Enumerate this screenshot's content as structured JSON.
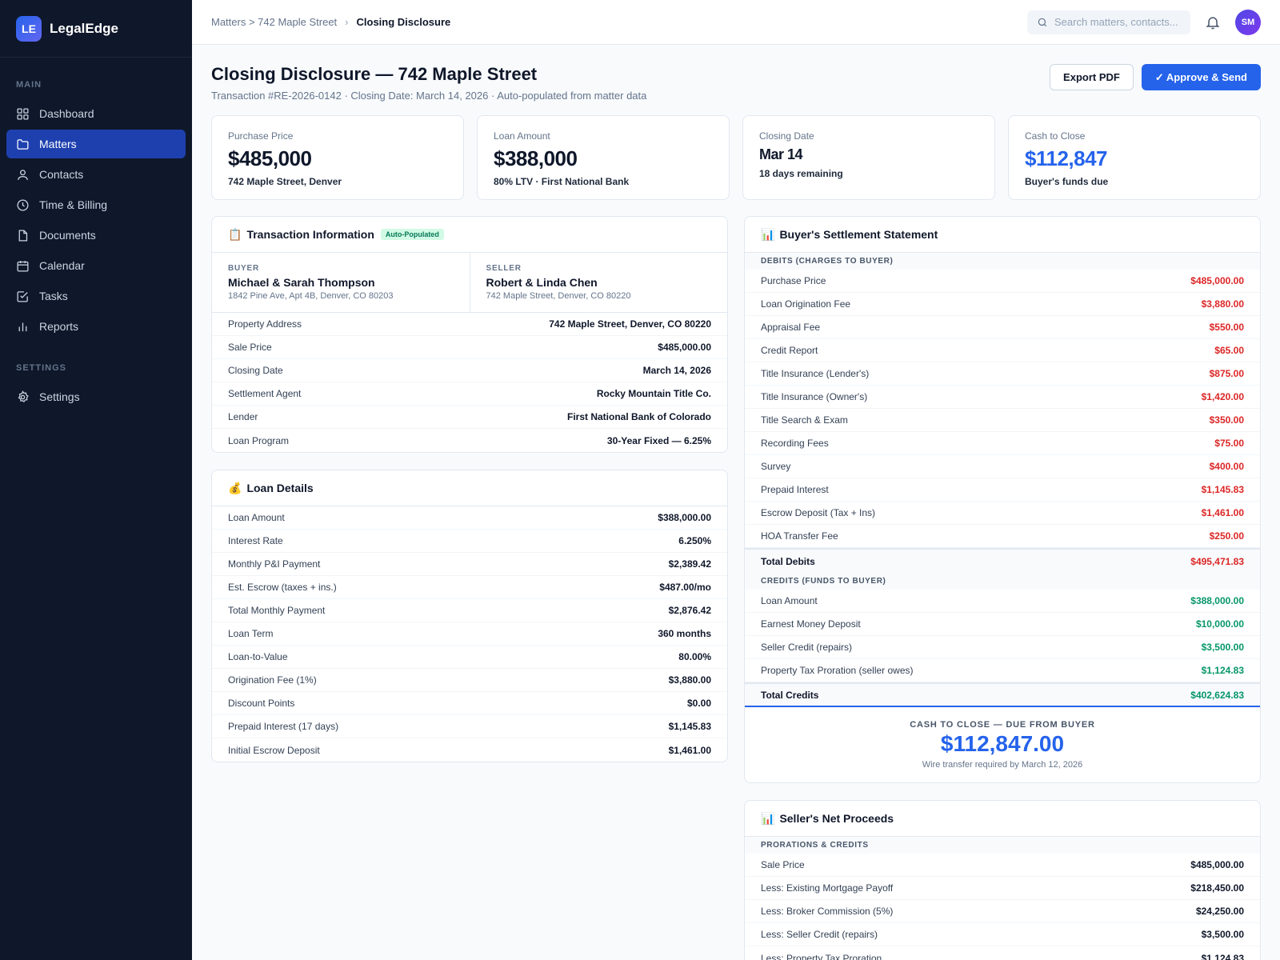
{
  "app": {
    "logo": "LE",
    "name": "LegalEdge"
  },
  "sidebar": {
    "main_label": "MAIN",
    "settings_label": "SETTINGS",
    "items": [
      {
        "label": "Dashboard",
        "icon": "dashboard-icon"
      },
      {
        "label": "Matters",
        "icon": "folder-icon",
        "active": true
      },
      {
        "label": "Contacts",
        "icon": "user-icon"
      },
      {
        "label": "Time & Billing",
        "icon": "clock-icon"
      },
      {
        "label": "Documents",
        "icon": "document-icon"
      },
      {
        "label": "Calendar",
        "icon": "calendar-icon"
      },
      {
        "label": "Tasks",
        "icon": "checkbox-icon"
      },
      {
        "label": "Reports",
        "icon": "bar-chart-icon"
      }
    ],
    "settings_items": [
      {
        "label": "Settings",
        "icon": "gear-icon"
      }
    ]
  },
  "topbar": {
    "breadcrumb_parent": "Matters > 742 Maple Street",
    "breadcrumb_sep": "›",
    "breadcrumb_current": "Closing Disclosure",
    "search_placeholder": "Search matters, contacts...",
    "avatar_initials": "SM"
  },
  "page": {
    "title": "Closing Disclosure — 742 Maple Street",
    "subtitle": "Transaction #RE-2026-0142 · Closing Date: March 14, 2026 · Auto-populated from matter data",
    "export_label": "Export PDF",
    "approve_label": "✓ Approve & Send"
  },
  "stats": [
    {
      "label": "Purchase Price",
      "value": "$485,000",
      "note": "742 Maple Street, Denver"
    },
    {
      "label": "Loan Amount",
      "value": "$388,000",
      "note": "80% LTV · First National Bank"
    },
    {
      "label": "Closing Date",
      "value": "Mar 14",
      "note": "18 days remaining"
    },
    {
      "label": "Cash to Close",
      "value": "$112,847",
      "note": "Buyer's funds due"
    }
  ],
  "transaction": {
    "emoji": "📋",
    "title": "Transaction Information",
    "badge": "Auto-Populated",
    "buyer": {
      "role": "BUYER",
      "name": "Michael & Sarah Thompson",
      "address": "1842 Pine Ave, Apt 4B, Denver, CO 80203"
    },
    "seller": {
      "role": "SELLER",
      "name": "Robert & Linda Chen",
      "address": "742 Maple Street, Denver, CO 80220"
    },
    "rows": [
      {
        "label": "Property Address",
        "value": "742 Maple Street, Denver, CO 80220"
      },
      {
        "label": "Sale Price",
        "value": "$485,000.00"
      },
      {
        "label": "Closing Date",
        "value": "March 14, 2026"
      },
      {
        "label": "Settlement Agent",
        "value": "Rocky Mountain Title Co."
      },
      {
        "label": "Lender",
        "value": "First National Bank of Colorado"
      },
      {
        "label": "Loan Program",
        "value": "30-Year Fixed — 6.25%"
      }
    ]
  },
  "loan": {
    "emoji": "💰",
    "title": "Loan Details",
    "rows": [
      {
        "label": "Loan Amount",
        "value": "$388,000.00"
      },
      {
        "label": "Interest Rate",
        "value": "6.250%"
      },
      {
        "label": "Monthly P&I Payment",
        "value": "$2,389.42"
      },
      {
        "label": "Est. Escrow (taxes + ins.)",
        "value": "$487.00/mo"
      },
      {
        "label": "Total Monthly Payment",
        "value": "$2,876.42"
      },
      {
        "label": "Loan Term",
        "value": "360 months"
      },
      {
        "label": "Loan-to-Value",
        "value": "80.00%"
      },
      {
        "label": "Origination Fee (1%)",
        "value": "$3,880.00"
      },
      {
        "label": "Discount Points",
        "value": "$0.00"
      },
      {
        "label": "Prepaid Interest (17 days)",
        "value": "$1,145.83"
      },
      {
        "label": "Initial Escrow Deposit",
        "value": "$1,461.00"
      }
    ]
  },
  "buyer_statement": {
    "emoji": "📊",
    "title": "Buyer's Settlement Statement",
    "debits_label": "DEBITS (CHARGES TO BUYER)",
    "debits": [
      {
        "label": "Purchase Price",
        "value": "$485,000.00"
      },
      {
        "label": "Loan Origination Fee",
        "value": "$3,880.00"
      },
      {
        "label": "Appraisal Fee",
        "value": "$550.00"
      },
      {
        "label": "Credit Report",
        "value": "$65.00"
      },
      {
        "label": "Title Insurance (Lender's)",
        "value": "$875.00"
      },
      {
        "label": "Title Insurance (Owner's)",
        "value": "$1,420.00"
      },
      {
        "label": "Title Search & Exam",
        "value": "$350.00"
      },
      {
        "label": "Recording Fees",
        "value": "$75.00"
      },
      {
        "label": "Survey",
        "value": "$400.00"
      },
      {
        "label": "Prepaid Interest",
        "value": "$1,145.83"
      },
      {
        "label": "Escrow Deposit (Tax + Ins)",
        "value": "$1,461.00"
      },
      {
        "label": "HOA Transfer Fee",
        "value": "$250.00"
      }
    ],
    "total_debits_label": "Total Debits",
    "total_debits": "$495,471.83",
    "credits_label": "CREDITS (FUNDS TO BUYER)",
    "credits": [
      {
        "label": "Loan Amount",
        "value": "$388,000.00"
      },
      {
        "label": "Earnest Money Deposit",
        "value": "$10,000.00"
      },
      {
        "label": "Seller Credit (repairs)",
        "value": "$3,500.00"
      },
      {
        "label": "Property Tax Proration (seller owes)",
        "value": "$1,124.83"
      }
    ],
    "total_credits_label": "Total Credits",
    "total_credits": "$402,624.83",
    "cash_label": "CASH TO CLOSE — DUE FROM BUYER",
    "cash_amount": "$112,847.00",
    "cash_note": "Wire transfer required by March 12, 2026"
  },
  "seller_proceeds": {
    "emoji": "📊",
    "title": "Seller's Net Proceeds",
    "section_label": "PRORATIONS & CREDITS",
    "rows": [
      {
        "label": "Sale Price",
        "value": "$485,000.00"
      },
      {
        "label": "Less: Existing Mortgage Payoff",
        "value": "$218,450.00"
      },
      {
        "label": "Less: Broker Commission (5%)",
        "value": "$24,250.00"
      },
      {
        "label": "Less: Seller Credit (repairs)",
        "value": "$3,500.00"
      },
      {
        "label": "Less: Property Tax Proration",
        "value": "$1,124.83"
      }
    ]
  },
  "colors": {
    "accent": "#2563eb",
    "sidebar": "#0f172a",
    "debit": "#dc2626",
    "credit": "#059669"
  }
}
